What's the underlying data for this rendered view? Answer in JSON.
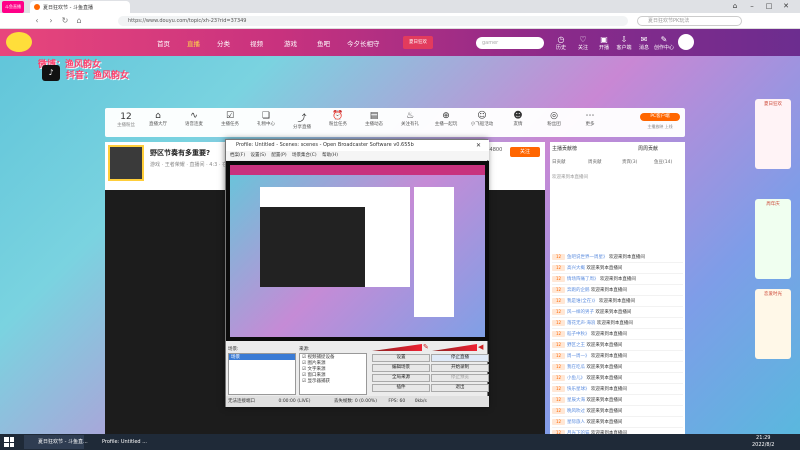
{
  "browser": {
    "tab_title": "夏日狂欢节 - 斗鱼直播",
    "badge": "斗鱼直播",
    "url": "https://www.douyu.com/topic/xh-23?rid=37349",
    "search_placeholder": "夏日狂欢节PK玩法",
    "win_controls": [
      "⌂",
      "–",
      "□",
      "✕"
    ]
  },
  "site": {
    "promo_line1": "微博：渔风韵女",
    "promo_line2": "抖音：渔风韵女",
    "nav": [
      "首页",
      "直播",
      "分类",
      "视频",
      "游戏",
      "鱼吧",
      "今夕长相守"
    ],
    "search_placeholder": "gamer",
    "badge_text": "夏日狂欢",
    "icons": [
      "历史",
      "关注",
      "开播",
      "客户端",
      "消息",
      "创作中心"
    ]
  },
  "icon_bar": {
    "count": "12",
    "count_label": "主播粉丝",
    "items": [
      "直播大厅",
      "语音连麦",
      "主播任务",
      "礼物中心",
      "分享直播",
      "粉丝任务",
      "主播动态",
      "关注有礼",
      "主播一起玩",
      "小飞船活动",
      "友情",
      "粉丝团",
      "更多"
    ],
    "pc_button": "PC客户端",
    "pc_sub": "主播放映 上线"
  },
  "room": {
    "title": "野区节奏有多重要?",
    "sub": "游戏 · 王者荣耀 · 直播间 · 4:3 · 在线1785人",
    "follow": "关注",
    "followers": "1784800",
    "badge": "钻石主播"
  },
  "obs": {
    "title": "Profile: Untitled - Scenes: scenes - Open Broadcaster Software v0.655b",
    "menu": [
      "档案(F)",
      "设置(S)",
      "配置(P)",
      "场景集合(C)",
      "帮助(H)"
    ],
    "scenes_label": "场景:",
    "sources_label": "来源:",
    "scene_item": "场景",
    "sources": [
      "视频捕捉设备",
      "图片来源",
      "文字来源",
      "窗口来源",
      "显示器捕获"
    ],
    "buttons": [
      "设置",
      "停止直播",
      "编辑场景",
      "开始录制",
      "全局来源",
      "停止预览",
      "插件",
      "退出"
    ],
    "status_left": "无法连接端口",
    "status_time": "0:00:00 (LIVE)",
    "status_drop": "丢失帧数: 0 (0.00%)",
    "status_fps": "FPS: 60",
    "status_kbps": "0kb/s"
  },
  "chat": {
    "tab_rank": "主播贡献榜",
    "tab_week": "周周贡献",
    "tabs": [
      "日贡献",
      "周贡献",
      "贵宾(3)",
      "鱼豆(14)"
    ],
    "notice": "欢迎来到本直播间",
    "messages": [
      {
        "lvl": "12",
        "user": "鱼吧说世界一周星》",
        "text": "欢迎来到本直播间"
      },
      {
        "lvl": "12",
        "user": "高兴大概",
        "text": "欢迎来到本直播间"
      },
      {
        "lvl": "12",
        "user": "情场阵痛了周》",
        "text": "欢迎来到本直播间"
      },
      {
        "lvl": "12",
        "user": "奔跑的企鹅",
        "text": "欢迎来到本直播间"
      },
      {
        "lvl": "12",
        "user": "我是谁(全在)》",
        "text": "欢迎来到本直播间"
      },
      {
        "lvl": "12",
        "user": "风一样的男子",
        "text": "欢迎来到本直播间"
      },
      {
        "lvl": "12",
        "user": "落花无声·海浪",
        "text": "欢迎来到本直播间"
      },
      {
        "lvl": "12",
        "user": "稻子中秋》",
        "text": "欢迎来到本直播间"
      },
      {
        "lvl": "12",
        "user": "野区之王",
        "text": "欢迎来到本直播间"
      },
      {
        "lvl": "12",
        "user": "周一周一》",
        "text": "欢迎来到本直播间"
      },
      {
        "lvl": "12",
        "user": "我在吃瓜",
        "text": "欢迎来到本直播间"
      },
      {
        "lvl": "12",
        "user": "小鱼儿》",
        "text": "欢迎来到本直播间"
      },
      {
        "lvl": "12",
        "user": "快乐星球》",
        "text": "欢迎来到本直播间"
      },
      {
        "lvl": "12",
        "user": "星辰大海",
        "text": "欢迎来到本直播间"
      },
      {
        "lvl": "12",
        "user": "晚风吹过",
        "text": "欢迎来到本直播间"
      },
      {
        "lvl": "12",
        "user": "星际旅人",
        "text": "欢迎来到本直播间"
      },
      {
        "lvl": "12",
        "user": "月光下的猫",
        "text": "欢迎来到本直播间"
      }
    ]
  },
  "right_cards": [
    "夏日狂欢",
    "周年庆",
    "恋爱时光"
  ],
  "taskbar": {
    "item1": "夏日狂欢节 - 斗鱼直...",
    "item2": "Profile: Untitled ...",
    "time": "21:29",
    "date": "2022/8/2"
  }
}
